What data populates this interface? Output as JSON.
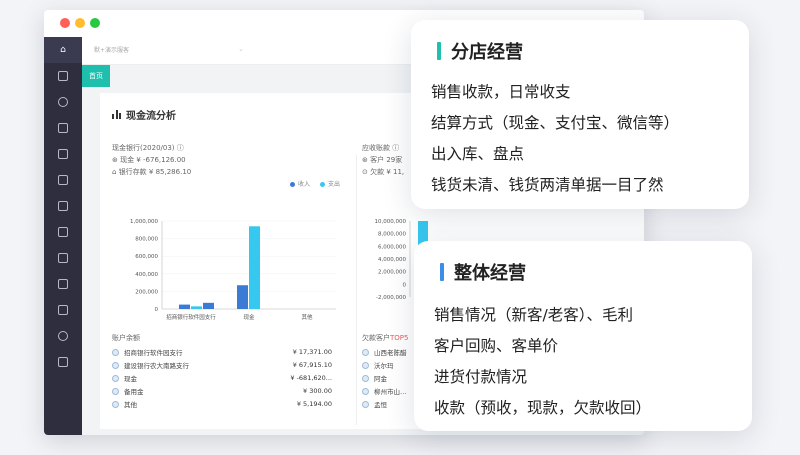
{
  "window": {
    "dots": [
      "#ff5f57",
      "#febc2e",
      "#28c840"
    ]
  },
  "topbar": {
    "store_select": "默+演示服客"
  },
  "tabs": {
    "home": "首页"
  },
  "panel": {
    "title": "现金流分析",
    "cash": {
      "heading": "现金银行(2020/03)",
      "cash_label": "现金",
      "cash_value": "¥ -676,126.00",
      "bank_label": "银行存款",
      "bank_value": "¥ 85,286.10"
    },
    "legend": [
      {
        "label": "收入",
        "color": "#3a7bd5"
      },
      {
        "label": "支出",
        "color": "#37c8f0"
      }
    ],
    "receivable": {
      "heading": "应收账款",
      "customer_label": "客户 29家",
      "debt_label": "欠款 ¥ 11,"
    },
    "accounts_title": "账户余额",
    "accounts": [
      {
        "name": "招商银行软件园支行",
        "amount": "¥ 17,371.00"
      },
      {
        "name": "建设银行农大南路支行",
        "amount": "¥ 67,915.10"
      },
      {
        "name": "现金",
        "amount": "¥ -681,620..."
      },
      {
        "name": "备用金",
        "amount": "¥ 300.00"
      },
      {
        "name": "其他",
        "amount": "¥ 5,194.00"
      }
    ],
    "debt_title": "欠款客户",
    "debt_top": "TOP5",
    "debtors": [
      "山西老陈醋",
      "沃尔玛",
      "阿金",
      "柳州市山…",
      "孟恒"
    ]
  },
  "chart_data": [
    {
      "type": "bar",
      "categories": [
        "招商银行软件园支行",
        "现金",
        "其他"
      ],
      "series": [
        {
          "name": "收入",
          "values": [
            50000,
            270000,
            0
          ]
        },
        {
          "name": "支出",
          "values": [
            30000,
            940000,
            0
          ]
        }
      ],
      "extra_bars": [
        {
          "category": "招商银行软件园支行",
          "value": 70000
        }
      ],
      "yticks": [
        "1,000,000",
        "800,000",
        "600,000",
        "400,000",
        "200,000",
        "0"
      ],
      "ylim": [
        0,
        1000000
      ],
      "colors": [
        "#3a7bd5",
        "#37c8f0"
      ]
    },
    {
      "type": "bar",
      "categories": [
        ""
      ],
      "series": [
        {
          "name": "",
          "values": [
            10000000
          ]
        }
      ],
      "yticks": [
        "10,000,000",
        "8,000,000",
        "6,000,000",
        "4,000,000",
        "2,000,000",
        "0",
        "-2,000,000"
      ],
      "ylim": [
        -2000000,
        10000000
      ]
    }
  ],
  "cards": [
    {
      "title": "分店经营",
      "accent": "#1fbfae",
      "lines": [
        "销售收款，日常收支",
        "结算方式（现金、支付宝、微信等）",
        "出入库、盘点",
        "钱货未清、钱货两清单据一目了然"
      ]
    },
    {
      "title": "整体经营",
      "accent": "#3a8ee6",
      "lines": [
        "销售情况（新客/老客）、毛利",
        "客户回购、客单价",
        "进货付款情况",
        "收款（预收，现款，欠款收回）"
      ]
    }
  ]
}
